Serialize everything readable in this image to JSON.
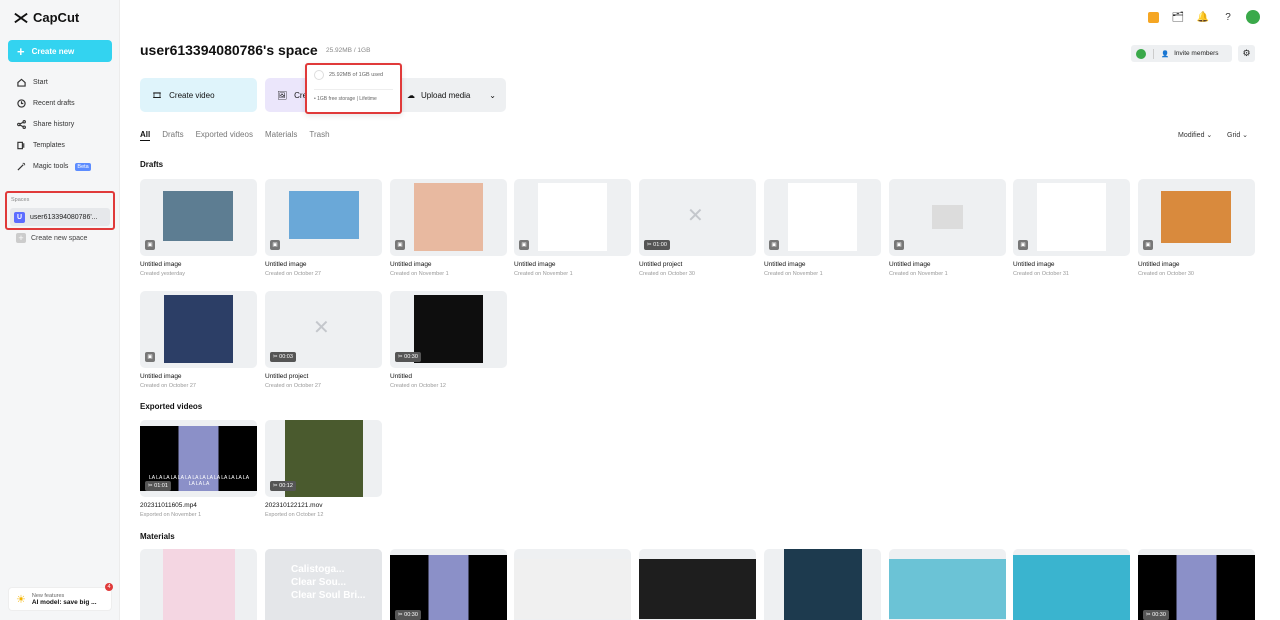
{
  "app": {
    "name": "CapCut"
  },
  "sidebar": {
    "create_label": "Create new",
    "nav": [
      {
        "label": "Start",
        "icon": "home-icon"
      },
      {
        "label": "Recent drafts",
        "icon": "clock-icon"
      },
      {
        "label": "Share history",
        "icon": "share-icon"
      },
      {
        "label": "Templates",
        "icon": "template-icon"
      },
      {
        "label": "Magic tools",
        "icon": "magic-wand-icon",
        "badge": "Beta"
      }
    ],
    "spaces_label": "Spaces",
    "space_item": "user613394080786'...",
    "space_avatar": "U",
    "new_space_label": "Create new space",
    "features": {
      "title": "New features",
      "text": "AI model: save big ...",
      "badge_count": "4"
    }
  },
  "header": {
    "title": "user613394080786's space",
    "usage": "25.92MB / 1GB",
    "invite_label": "Invite members"
  },
  "actions": {
    "create_video": "Create video",
    "create_image": "Cre",
    "upload_media": "Upload media"
  },
  "storage_popover": {
    "used": "25.92MB of 1GB used",
    "plan": "1GB free storage",
    "duration": "Lifetime"
  },
  "tabs": [
    "All",
    "Drafts",
    "Exported videos",
    "Materials",
    "Trash"
  ],
  "sort": {
    "modified": "Modified",
    "grid": "Grid"
  },
  "sections": {
    "drafts": "Drafts",
    "exported": "Exported videos",
    "materials": "Materials"
  },
  "drafts": [
    {
      "name": "Untitled image",
      "date": "Created yesterday",
      "kind": "image"
    },
    {
      "name": "Untitled image",
      "date": "Created on October 27",
      "kind": "image"
    },
    {
      "name": "Untitled image",
      "date": "Created on November 1",
      "kind": "image"
    },
    {
      "name": "Untitled image",
      "date": "Created on November 1",
      "kind": "image"
    },
    {
      "name": "Untitled project",
      "date": "Created on October 30",
      "kind": "video",
      "duration": "01:00"
    },
    {
      "name": "Untitled image",
      "date": "Created on November 1",
      "kind": "image"
    },
    {
      "name": "Untitled image",
      "date": "Created on November 1",
      "kind": "image"
    },
    {
      "name": "Untitled image",
      "date": "Created on October 31",
      "kind": "image"
    },
    {
      "name": "Untitled image",
      "date": "Created on October 30",
      "kind": "image"
    },
    {
      "name": "Untitled image",
      "date": "Created on October 27",
      "kind": "image"
    },
    {
      "name": "Untitled project",
      "date": "Created on October 27",
      "kind": "video",
      "duration": "00:03"
    },
    {
      "name": "Untitled",
      "date": "Created on October 12",
      "kind": "video",
      "duration": "00:30"
    }
  ],
  "exported": [
    {
      "name": "202311011605.mp4",
      "date": "Exported on November 1",
      "duration": "01:01",
      "caption": "LA LA LA LA LA LA LA LA LA LA LA LA LA LA LA LA LA"
    },
    {
      "name": "202310122121.mov",
      "date": "Exported on October 12",
      "duration": "00:12"
    }
  ],
  "materials": [
    {
      "duration": ""
    },
    {
      "duration": "",
      "text": "Calistoga... Clear Sou... Clear Soul Bri..."
    },
    {
      "duration": "00:30"
    },
    {
      "duration": ""
    },
    {
      "duration": ""
    },
    {
      "duration": ""
    },
    {
      "duration": ""
    },
    {
      "duration": ""
    },
    {
      "duration": "00:30"
    }
  ]
}
